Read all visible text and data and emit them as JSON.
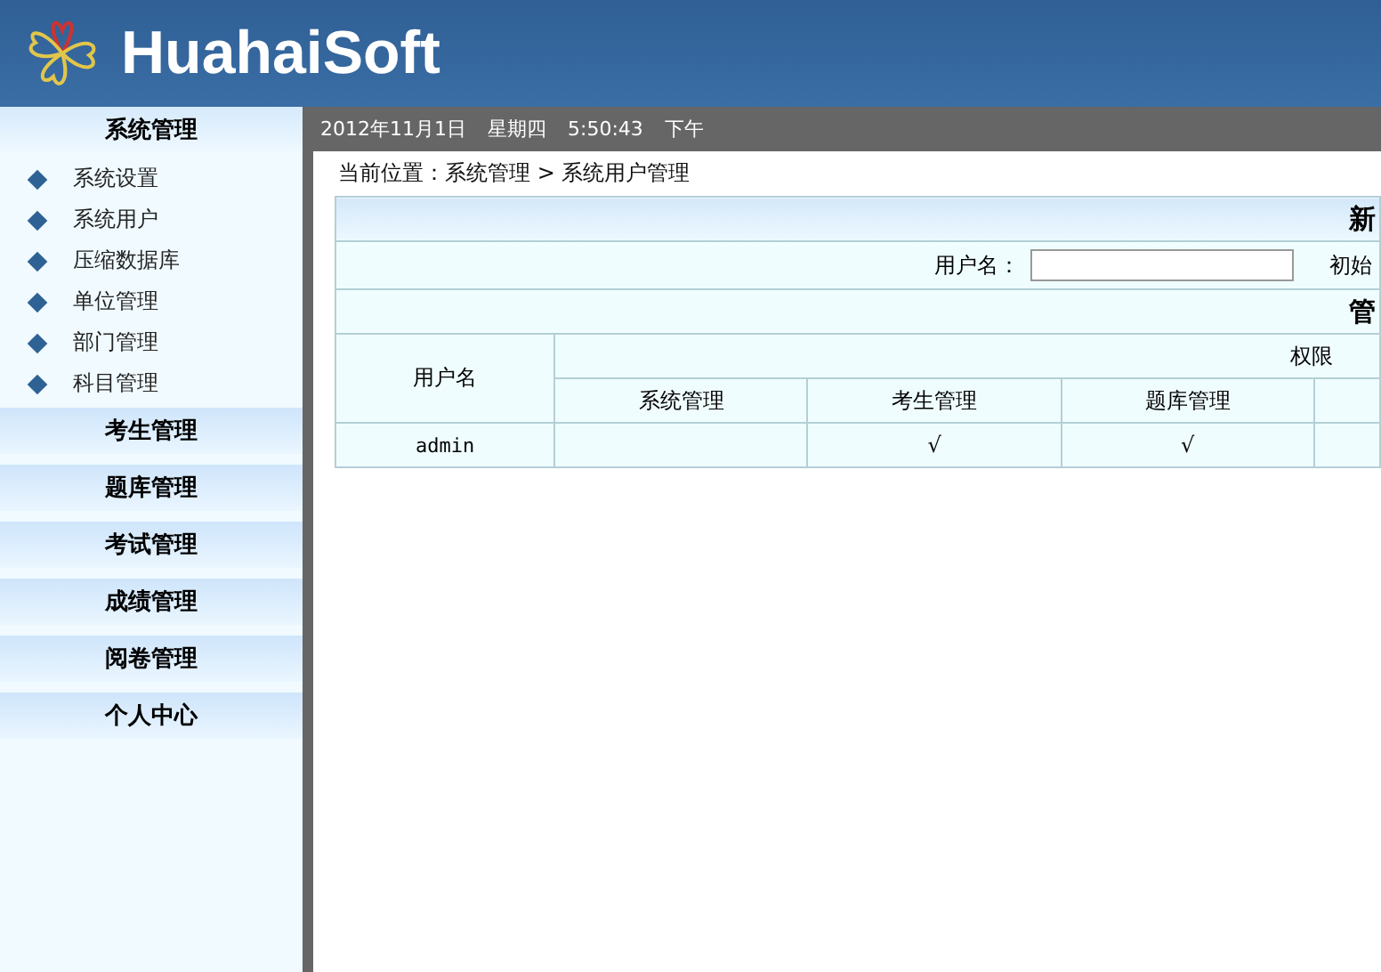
{
  "header": {
    "brand": "HuahaiSoft"
  },
  "sidebar": {
    "title": "系统管理",
    "items": [
      "系统设置",
      "系统用户",
      "压缩数据库",
      "单位管理",
      "部门管理",
      "科目管理"
    ],
    "sections": [
      "考生管理",
      "题库管理",
      "考试管理",
      "成绩管理",
      "阅卷管理",
      "个人中心"
    ]
  },
  "status_bar": {
    "date": "2012年11月1日",
    "weekday": "星期四",
    "time": "5:50:43",
    "period": "下午"
  },
  "breadcrumb": "当前位置：系统管理 > 系统用户管理",
  "new_user_form": {
    "title": "新",
    "username_label": "用户名：",
    "next_label": "初始"
  },
  "user_table": {
    "title": "管",
    "username_header": "用户名",
    "permissions_header": "权限",
    "columns": [
      "系统管理",
      "考生管理",
      "题库管理",
      ""
    ],
    "rows": [
      {
        "username": "admin",
        "cells": [
          "",
          "√",
          "√",
          ""
        ]
      }
    ]
  }
}
